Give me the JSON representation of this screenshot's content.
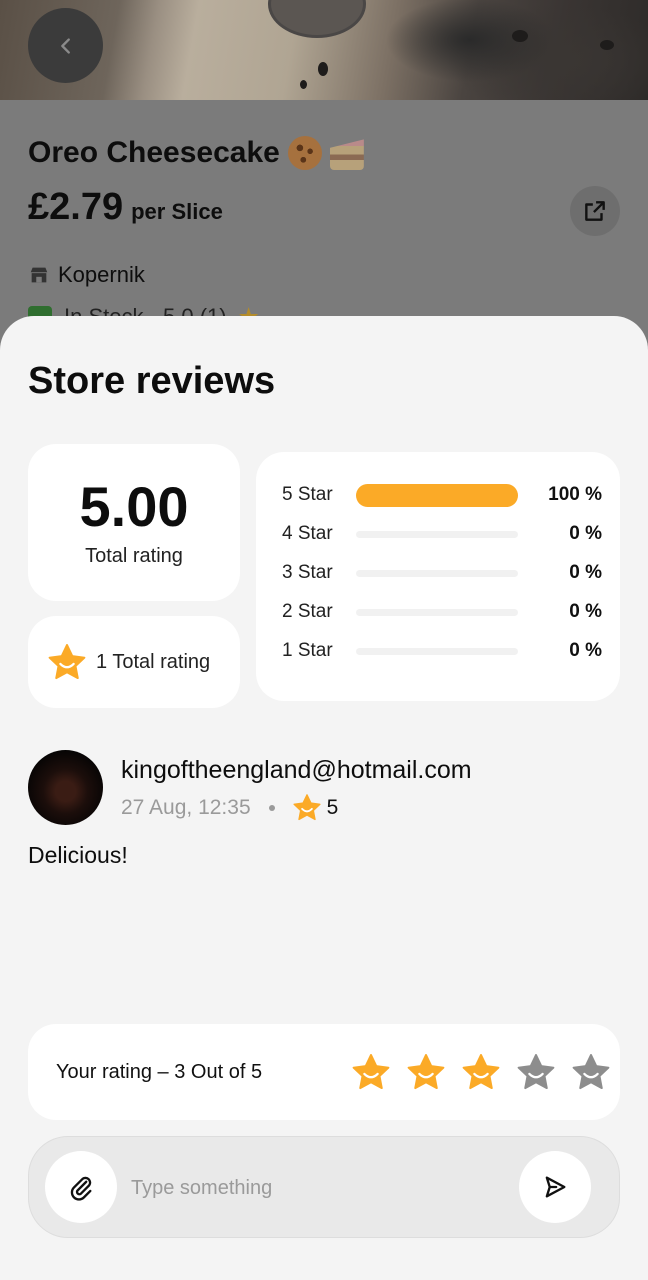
{
  "product": {
    "name": "Oreo Cheesecake",
    "emojis": [
      "cookie-icon",
      "cake-icon"
    ],
    "price": "£2.79",
    "price_unit": "per Slice",
    "store": "Kopernik",
    "peek_line": "In Stock · 5.0 (1)"
  },
  "sheet": {
    "title": "Store reviews",
    "total_rating_value": "5.00",
    "total_rating_label": "Total rating",
    "total_count_label": "1 Total rating",
    "distribution": [
      {
        "label": "5 Star",
        "percent": 100,
        "percent_text": "100 %"
      },
      {
        "label": "4 Star",
        "percent": 0,
        "percent_text": "0 %"
      },
      {
        "label": "3 Star",
        "percent": 0,
        "percent_text": "0 %"
      },
      {
        "label": "2 Star",
        "percent": 0,
        "percent_text": "0 %"
      },
      {
        "label": "1 Star",
        "percent": 0,
        "percent_text": "0 %"
      }
    ]
  },
  "review": {
    "author": "kingoftheengland@hotmail.com",
    "date": "27 Aug, 12:35",
    "rating": "5",
    "text": "Delicious!"
  },
  "your_rating": {
    "label": "Your rating – 3 Out of 5",
    "value": 3,
    "max": 5
  },
  "composer": {
    "placeholder": "Type something"
  },
  "colors": {
    "accent": "#fbaa27",
    "star_inactive": "#8d8d8d",
    "sheet_bg": "#f4f4f4",
    "card_bg": "#ffffff",
    "overlay": "#7b7b7b"
  }
}
